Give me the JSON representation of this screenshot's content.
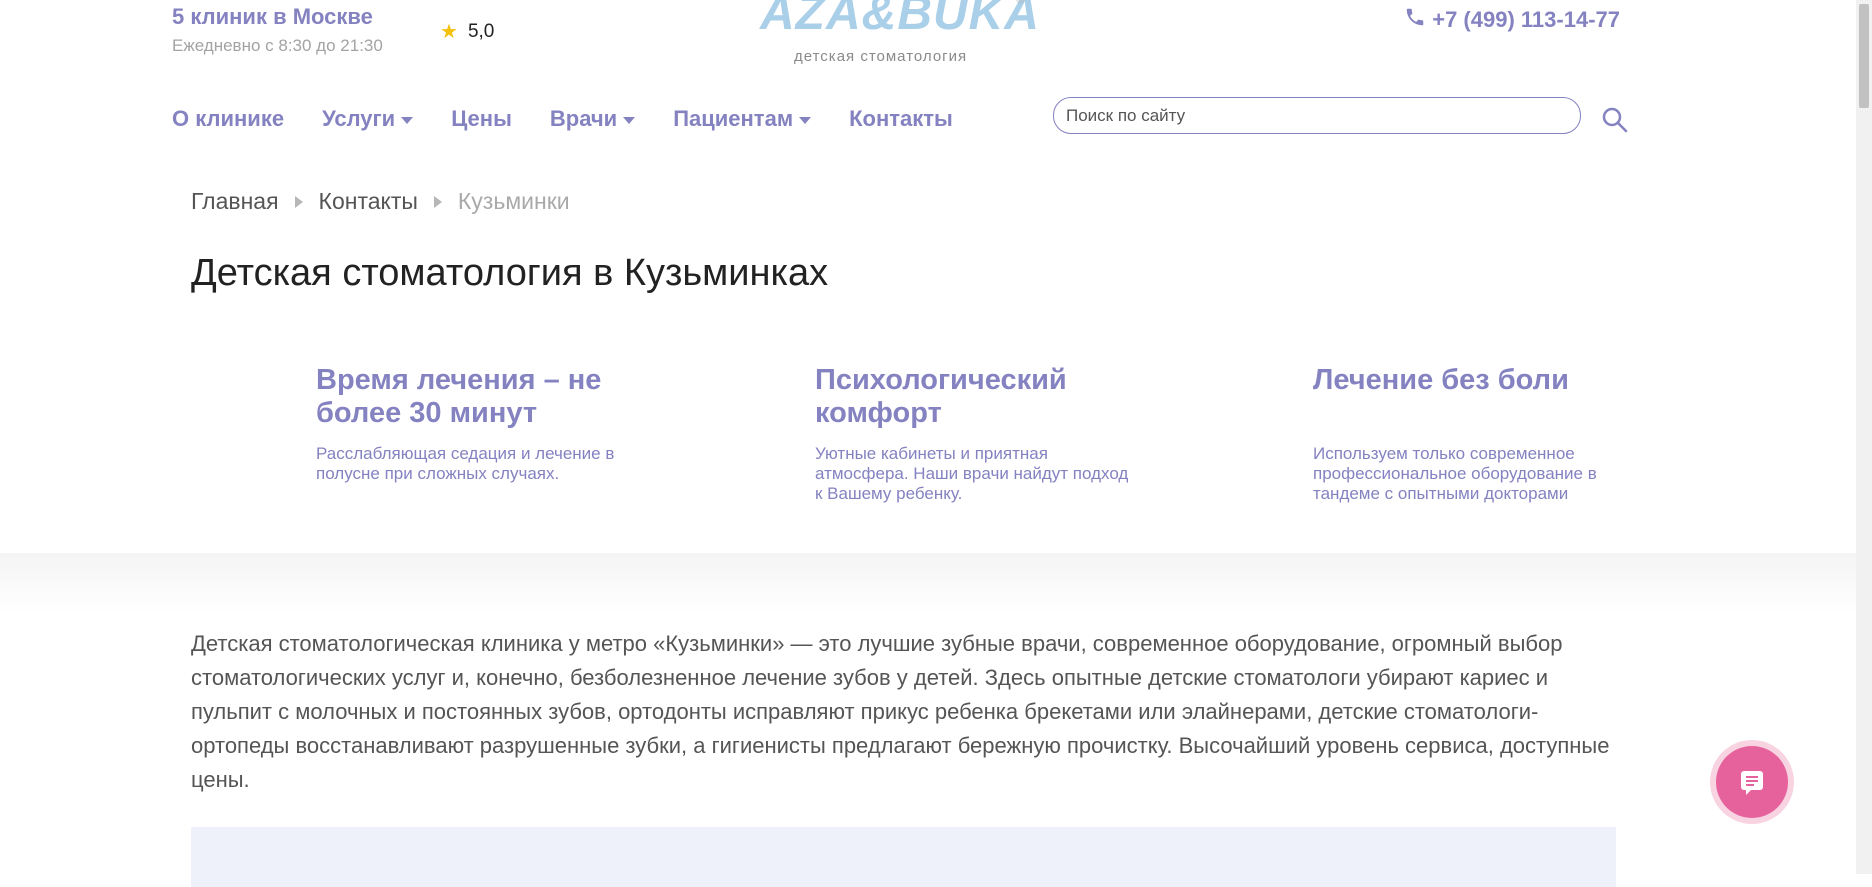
{
  "header": {
    "clinics_title": "5 клиник в Москве",
    "clinics_hours": "Ежедневно с 8:30 до 21:30",
    "rating": "5,0",
    "logo_text": "AZA&BÜKA",
    "logo_reg": "®",
    "logo_sub": "детская стоматология",
    "phone": "+7 (499) 113-14-77"
  },
  "nav": {
    "items": [
      {
        "label": "О клинике"
      },
      {
        "label": "Услуги"
      },
      {
        "label": "Цены"
      },
      {
        "label": "Врачи"
      },
      {
        "label": "Пациентам"
      },
      {
        "label": "Контакты"
      }
    ]
  },
  "search": {
    "placeholder": "Поиск по сайту",
    "value": ""
  },
  "breadcrumb": {
    "items": [
      "Главная",
      "Контакты",
      "Кузьминки"
    ]
  },
  "page": {
    "title": "Детская стоматология в Кузьминках"
  },
  "features": [
    {
      "title": "Время лечения – не более 30 минут",
      "text": "Расслабляющая седация и лечение в полусне при сложных случаях."
    },
    {
      "title": "Психологический комфорт",
      "text": "Уютные кабинеты и приятная атмосфера. Наши врачи найдут подход к Вашему ребенку."
    },
    {
      "title": "Лечение без боли",
      "text": "Используем только современное профессиональное оборудование в тандеме с опытными докторами"
    }
  ],
  "intro": "Детская стоматологическая клиника у метро «Кузьминки» — это лучшие зубные врачи, современное оборудование, огромный выбор стоматологических услуг и, конечно, безболезненное лечение зубов у детей. Здесь опытные детские стоматологи убирают кариес и пульпит с молочных и постоянных зубов, ортодонты исправляют прикус ребенка брекетами или элайнерами, детские стоматологи-ортопеды восстанавливают разрушенные зубки, а гигиенисты предлагают бережную прочистку. Высочайший уровень сервиса, доступные цены.",
  "icons": {
    "star": "star-icon",
    "phone": "phone-icon",
    "search": "search-icon",
    "chat": "chat-icon"
  },
  "colors": {
    "accent": "#8482c0",
    "star": "#f4c20d",
    "chat": "#e6629d",
    "logo": "#a9cfe9"
  }
}
